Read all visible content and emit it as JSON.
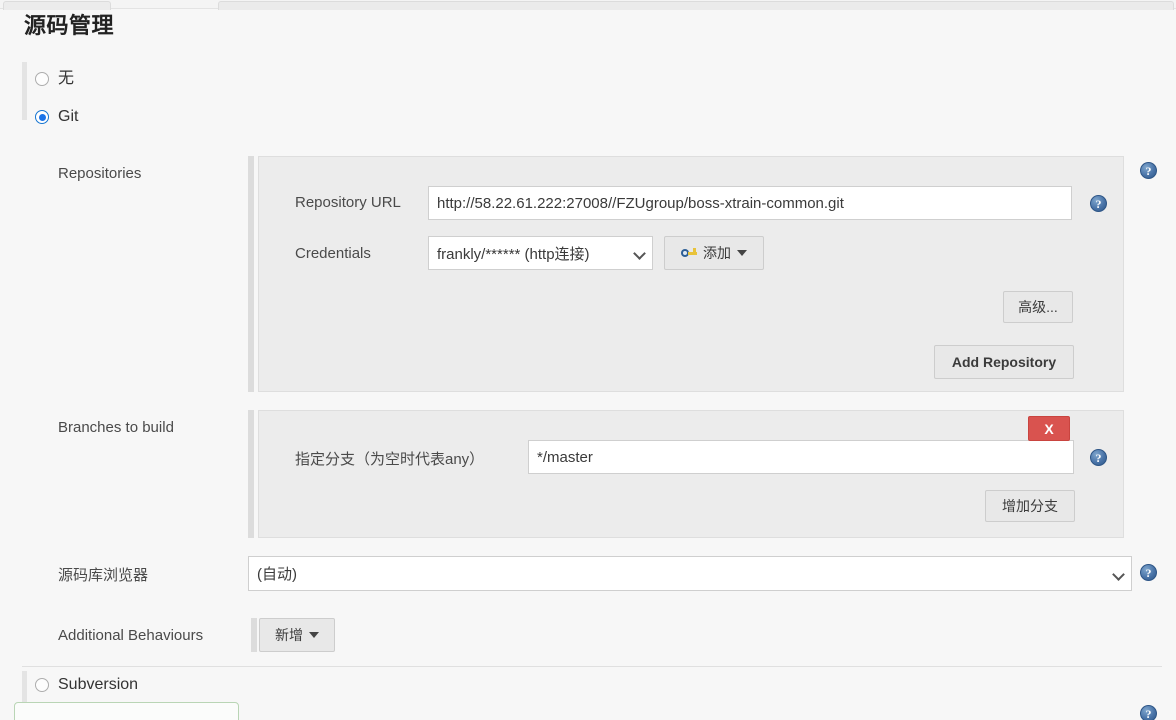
{
  "page": {
    "title": "源码管理"
  },
  "scm_options": [
    {
      "label": "无",
      "checked": false
    },
    {
      "label": "Git",
      "checked": true
    },
    {
      "label": "Subversion",
      "checked": false
    }
  ],
  "git": {
    "repositories": {
      "label": "Repositories",
      "url_label": "Repository URL",
      "url_value": "http://58.22.61.222:27008//FZUgroup/boss-xtrain-common.git",
      "credentials_label": "Credentials",
      "credentials_value": "frankly/****** (http连接)",
      "add_credentials_label": "添加",
      "advanced_label": "高级...",
      "add_repository_label": "Add Repository"
    },
    "branches": {
      "label": "Branches to build",
      "specifier_label": "指定分支（为空时代表any）",
      "specifier_value": "*/master",
      "delete_label": "X",
      "add_branch_label": "增加分支"
    },
    "browser": {
      "label": "源码库浏览器",
      "value": "(自动)"
    },
    "additional_behaviours": {
      "label": "Additional Behaviours",
      "add_label": "新增"
    }
  },
  "icons": {
    "help": "?",
    "key": "key-icon",
    "caret": "chevron-down"
  },
  "colors": {
    "accent": "#1a73e8",
    "danger": "#d9534f",
    "panel": "#ececec",
    "page": "#f7f7f7",
    "help": "#2e5687"
  }
}
